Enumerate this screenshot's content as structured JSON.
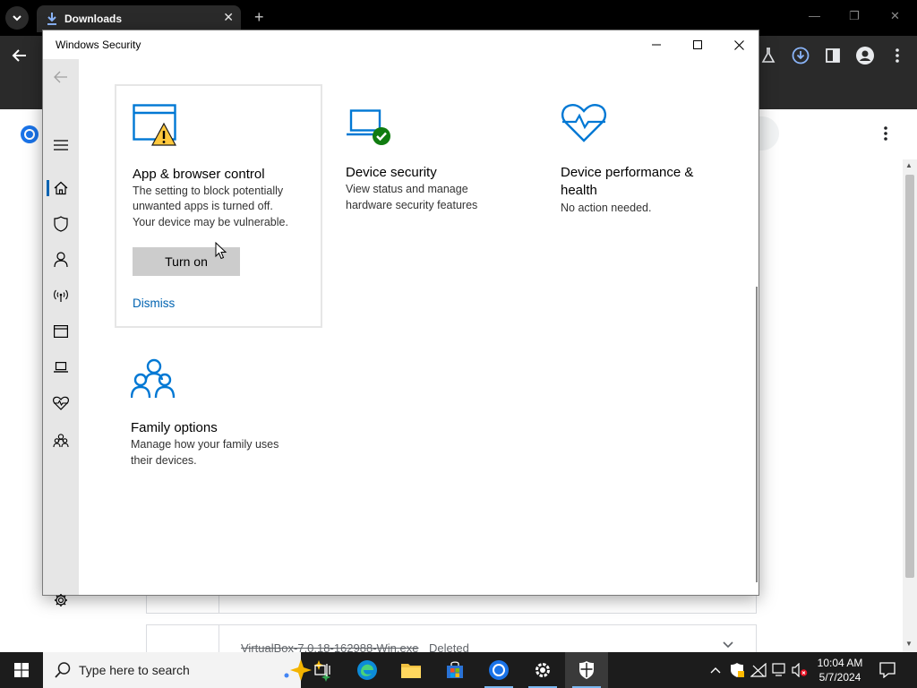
{
  "browser": {
    "tab_title": "Downloads",
    "tab_close": "✕",
    "new_tab": "+",
    "minimize": "—",
    "restore": "❐",
    "close": "✕",
    "toolbar_icons": [
      "back-arrow-icon",
      "labs-flask-icon",
      "download-icon",
      "side-panel-icon",
      "profile-icon",
      "menu-icon"
    ]
  },
  "downloads_page": {
    "partial_row": {
      "filename": "VirtualBox-7.0.18-162988-Win.exe",
      "status": "Deleted"
    }
  },
  "security_window": {
    "title": "Windows Security",
    "controls": {
      "minimize": "—",
      "maximize": "☐",
      "close": "✕"
    },
    "sidebar": {
      "items": [
        {
          "name": "back",
          "icon": "back-arrow-icon"
        },
        {
          "name": "menu",
          "icon": "hamburger-icon"
        },
        {
          "name": "home",
          "icon": "home-icon",
          "active": true
        },
        {
          "name": "virus-protection",
          "icon": "shield-icon"
        },
        {
          "name": "account-protection",
          "icon": "person-icon"
        },
        {
          "name": "firewall",
          "icon": "antenna-icon"
        },
        {
          "name": "app-browser-control",
          "icon": "browser-window-icon"
        },
        {
          "name": "device-security",
          "icon": "laptop-icon"
        },
        {
          "name": "device-performance",
          "icon": "heart-pulse-icon"
        },
        {
          "name": "family-options",
          "icon": "family-icon"
        },
        {
          "name": "settings",
          "icon": "gear-icon"
        }
      ]
    },
    "cards": {
      "app_browser": {
        "title": "App & browser control",
        "desc_1": "The setting to block potentially",
        "desc_2": "unwanted apps is turned off.",
        "desc_3": "Your device may be vulnerable.",
        "button": "Turn on",
        "link": "Dismiss"
      },
      "device_security": {
        "title": "Device security",
        "desc_1": "View status and manage",
        "desc_2": "hardware security features"
      },
      "device_performance": {
        "title_1": "Device performance &",
        "title_2": "health",
        "desc_1": "No action needed."
      },
      "family": {
        "title": "Family options",
        "desc_1": "Manage how your family uses",
        "desc_2": "their devices."
      }
    },
    "colors": {
      "accent": "#0063b1",
      "icon_blue": "#0078d4",
      "warning": "#ffc83d",
      "ok_green": "#107c10"
    }
  },
  "taskbar": {
    "search_placeholder": "Type here to search",
    "apps": [
      "task-view-icon",
      "edge-icon",
      "file-explorer-icon",
      "store-icon",
      "chrome-icon",
      "settings-icon",
      "windows-security-icon"
    ],
    "time": "10:04 AM",
    "date": "5/7/2024"
  }
}
